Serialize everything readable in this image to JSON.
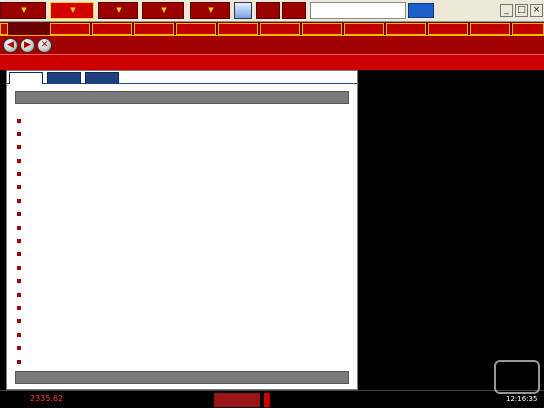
{
  "menubar": {
    "items": [
      {
        "label": "",
        "active": false
      },
      {
        "label": "",
        "active": true
      },
      {
        "label": "",
        "active": false
      },
      {
        "label": "",
        "active": false
      },
      {
        "label": "",
        "active": false
      },
      {
        "label": "",
        "active": false
      },
      {
        "label": "",
        "active": false
      }
    ],
    "window_title": "",
    "logo_text": ""
  },
  "toolbar": {
    "items": [
      "",
      "",
      "",
      "",
      "",
      "",
      "",
      "",
      "",
      "",
      "",
      ""
    ]
  },
  "page_header": {
    "title": ""
  },
  "tabs": [
    {
      "label": "",
      "active": true
    },
    {
      "label": "",
      "active": false
    },
    {
      "label": "",
      "active": false
    }
  ],
  "section_china": "",
  "section_other": "",
  "news": [
    {
      "title": "",
      "datetime": ""
    },
    {
      "title": "",
      "datetime": ""
    },
    {
      "title": "",
      "datetime": ""
    },
    {
      "title": "",
      "datetime": ""
    },
    {
      "title": "",
      "datetime": ""
    },
    {
      "title": "",
      "datetime": ""
    },
    {
      "title": "",
      "datetime": ""
    },
    {
      "title": "",
      "datetime": ""
    },
    {
      "title": "",
      "datetime": ""
    },
    {
      "title": "",
      "datetime": ""
    },
    {
      "title": "",
      "datetime": ""
    },
    {
      "title": "",
      "datetime": ""
    },
    {
      "title": "",
      "datetime": ""
    },
    {
      "title": "",
      "datetime": ""
    },
    {
      "title": "",
      "datetime": ""
    },
    {
      "title": "",
      "datetime": ""
    },
    {
      "title": "",
      "datetime": ""
    },
    {
      "title": "",
      "datetime": ""
    },
    {
      "title": "",
      "datetime": ""
    },
    {
      "title": "",
      "datetime": ""
    }
  ],
  "other_news_preview": "",
  "status": {
    "index_label": "",
    "index_value": "2335.62",
    "change": "",
    "amount": "",
    "segment2": "",
    "segment3": "",
    "segment4": "",
    "index2_label": "",
    "segment5": "",
    "segment6": "",
    "segment7": "",
    "time": "12:16:35"
  },
  "watermark_text": "",
  "colors": {
    "brand_red": "#cc0000",
    "dark_red": "#9a0000",
    "tab_blue": "#1f3f7f"
  }
}
